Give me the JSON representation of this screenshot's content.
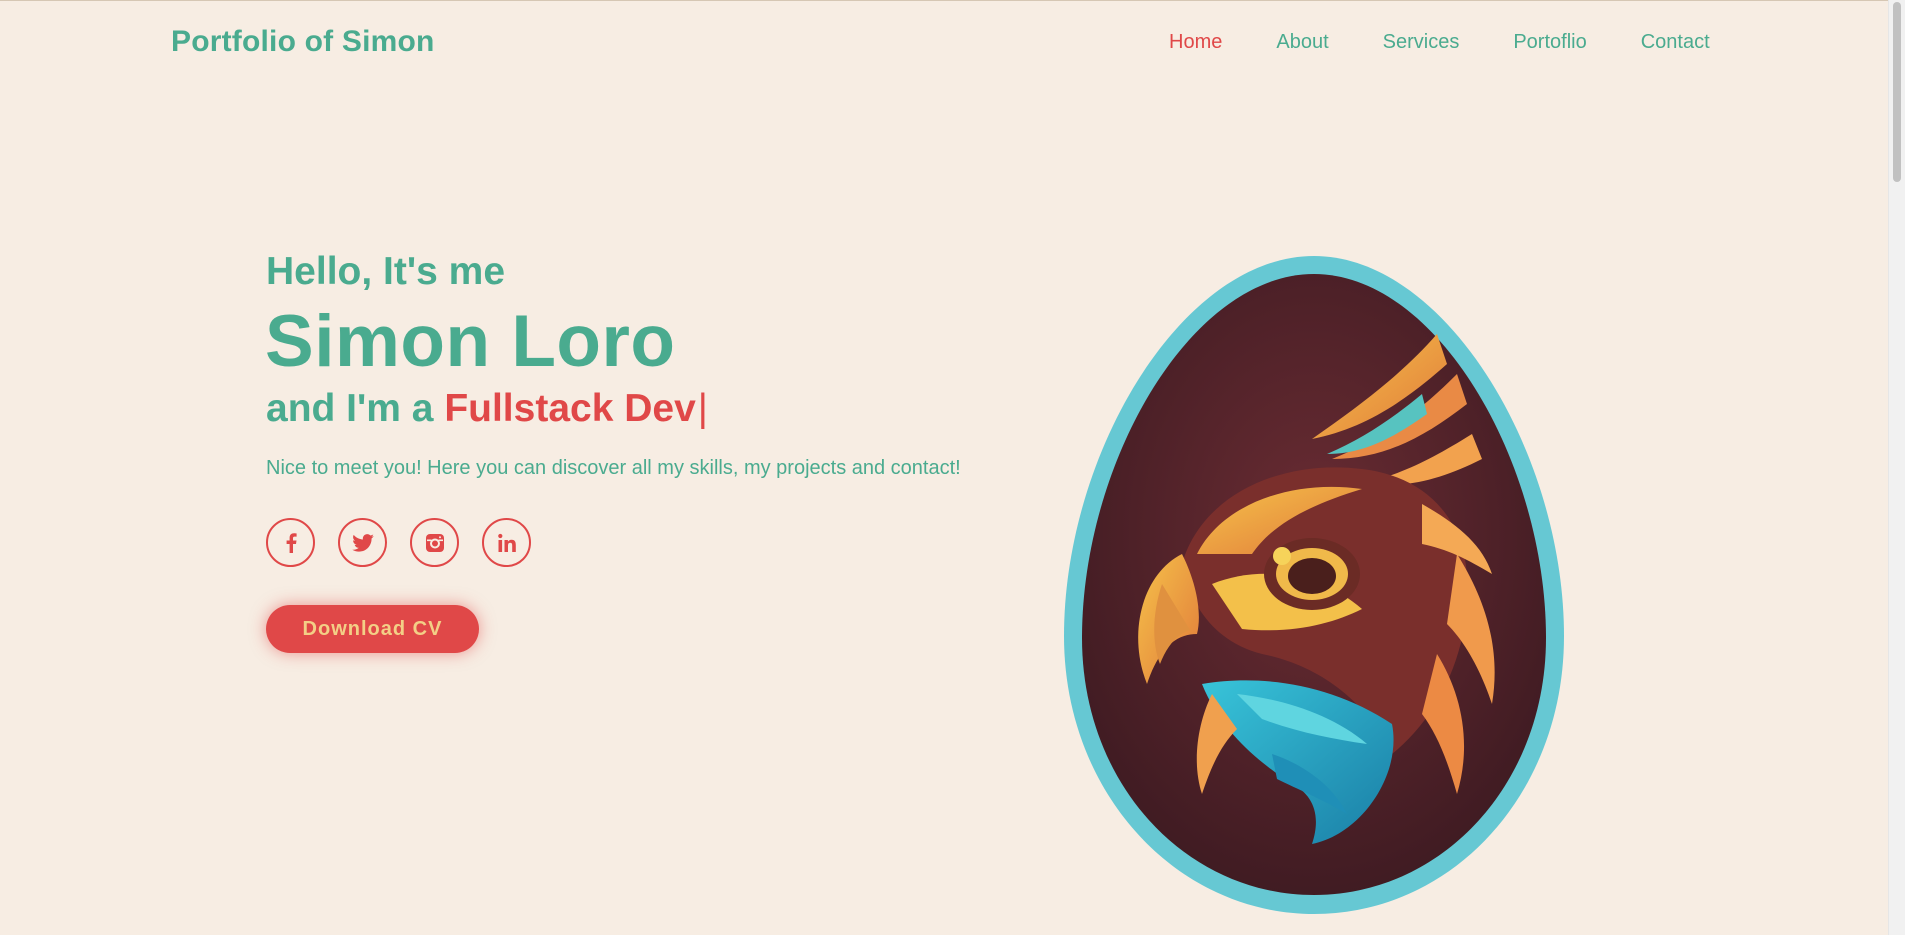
{
  "header": {
    "logo": "Portfolio of Simon",
    "nav": [
      {
        "label": "Home",
        "active": true
      },
      {
        "label": "About",
        "active": false
      },
      {
        "label": "Services",
        "active": false
      },
      {
        "label": "Portoflio",
        "active": false
      },
      {
        "label": "Contact",
        "active": false
      }
    ]
  },
  "hero": {
    "greeting": "Hello, It's me",
    "name": "Simon Loro",
    "role_prefix": "and I'm a ",
    "role_highlight": "Fullstack Dev",
    "caret": "|",
    "intro": "Nice to meet you! Here you can discover all my skills, my projects and contact!",
    "socials": [
      {
        "icon": "facebook-icon"
      },
      {
        "icon": "twitter-icon"
      },
      {
        "icon": "instagram-icon"
      },
      {
        "icon": "linkedin-icon"
      }
    ],
    "cv_button": "Download CV"
  },
  "colors": {
    "background": "#f7ede3",
    "primary": "#4aab8f",
    "accent": "#e04848",
    "button_text": "#f3cf86",
    "emblem_ring": "#66c8d3",
    "emblem_fill": "#4b2028"
  },
  "image": {
    "icon": "eagle-emblem-icon"
  }
}
